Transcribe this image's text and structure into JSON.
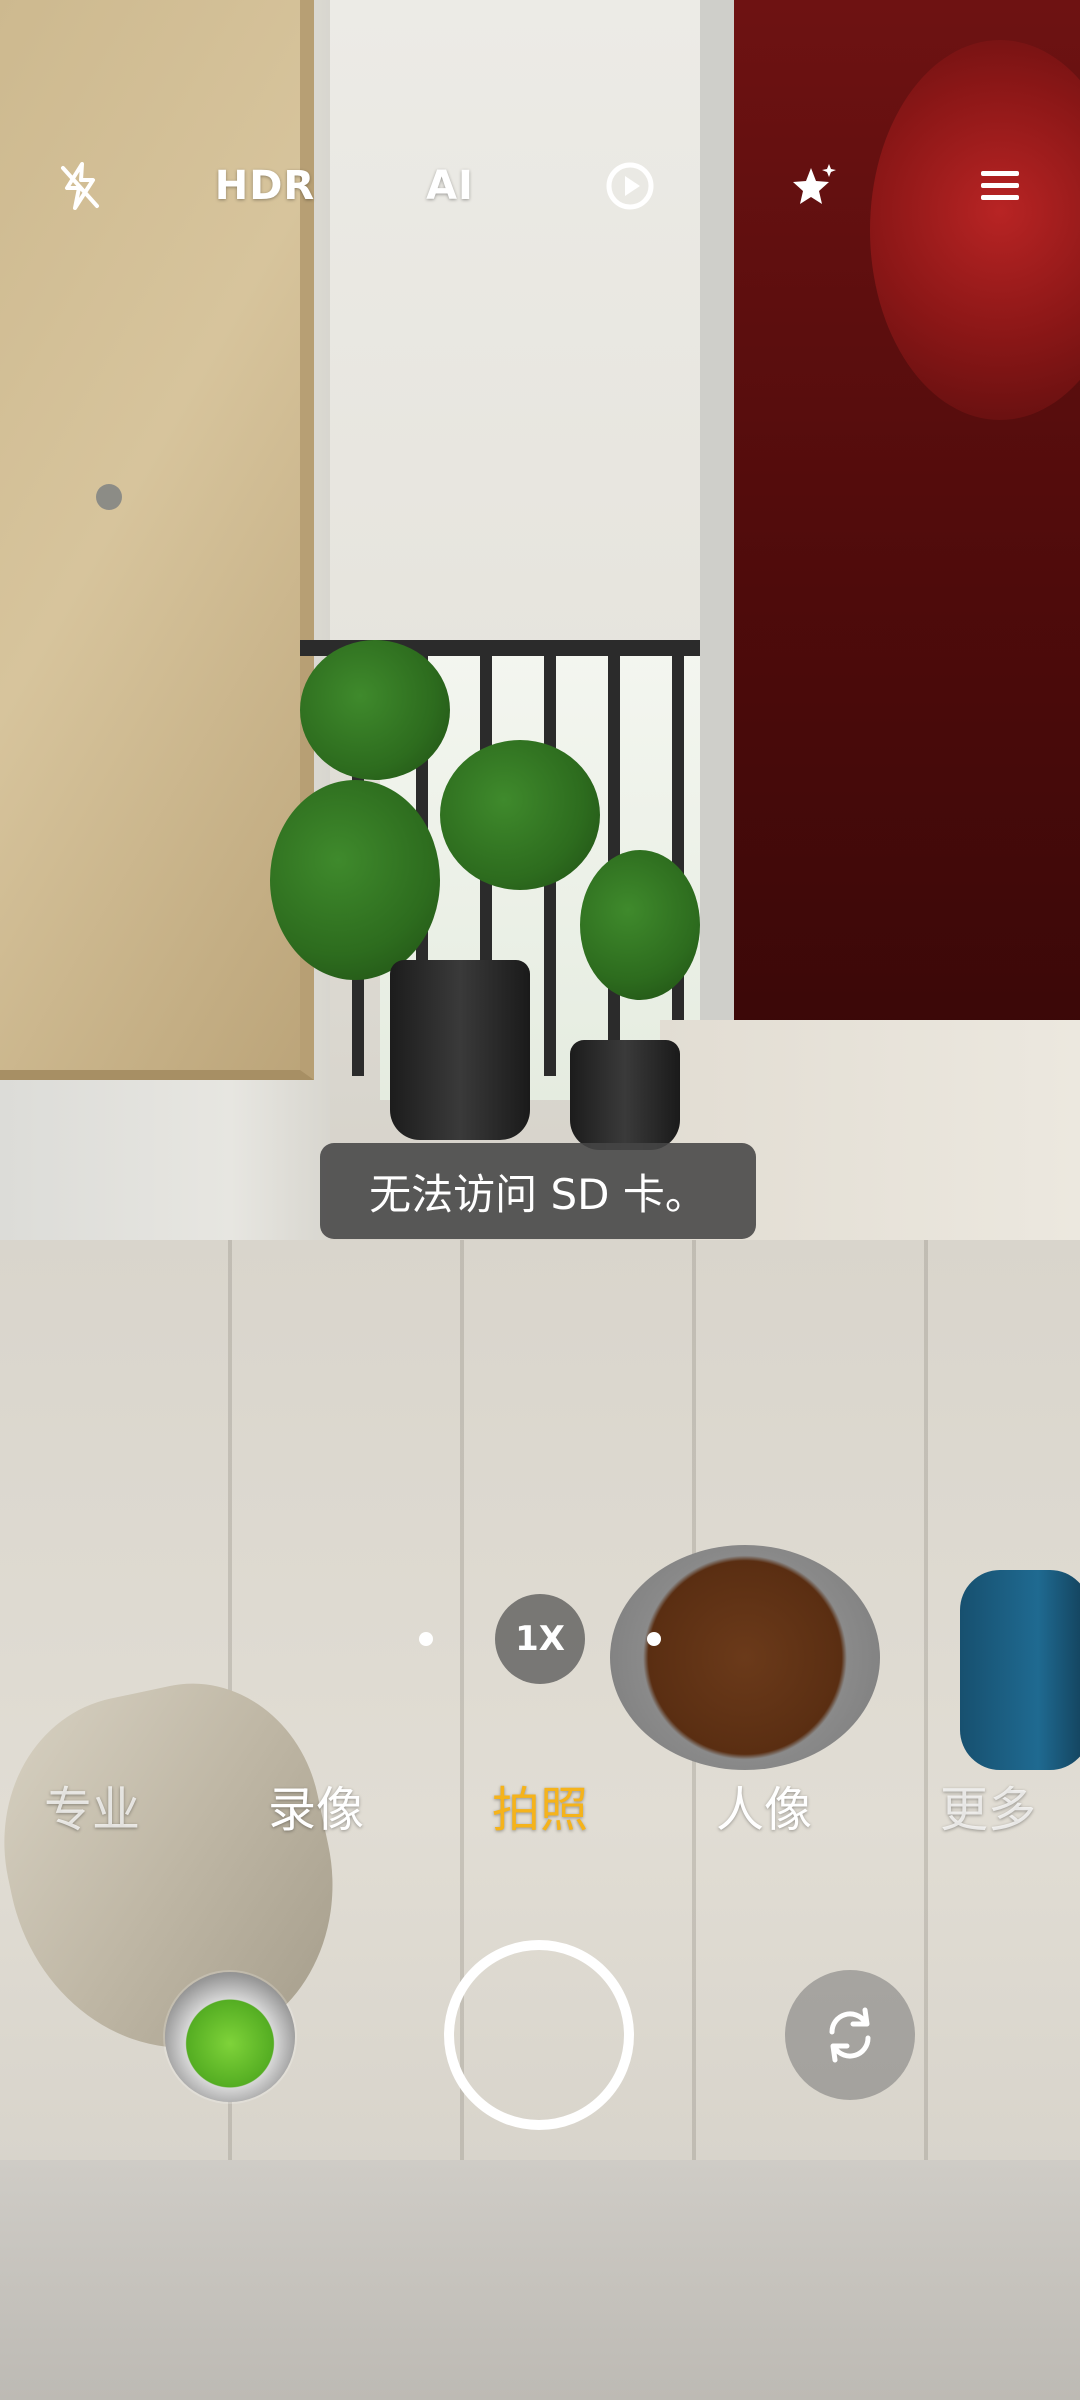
{
  "top_bar": {
    "flash_icon": "flash-off-icon",
    "hdr_label": "HDR",
    "ai_label": "AI",
    "motion_icon": "live-photo-icon",
    "effects_icon": "magic-star-icon",
    "menu_icon": "hamburger-menu-icon"
  },
  "toast": {
    "message": "无法访问 SD 卡。"
  },
  "zoom": {
    "label": "1X"
  },
  "modes": {
    "items": [
      {
        "label": "专业"
      },
      {
        "label": "录像"
      },
      {
        "label": "拍照"
      },
      {
        "label": "人像"
      },
      {
        "label": "更多"
      }
    ],
    "active_index": 2,
    "active_color": "#f5b31b"
  },
  "bottom": {
    "gallery_icon": "gallery-thumbnail",
    "shutter_icon": "shutter-button",
    "switch_icon": "switch-camera-icon"
  }
}
